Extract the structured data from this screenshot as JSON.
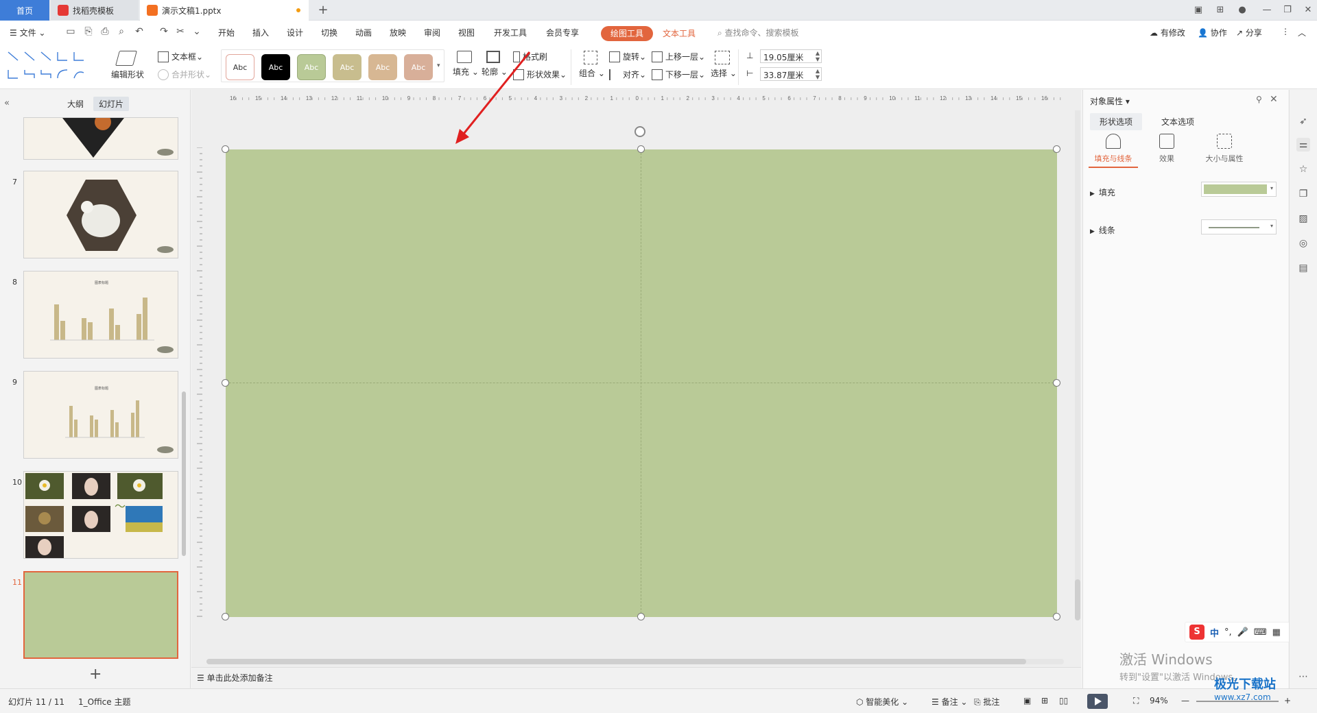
{
  "tabs": [
    {
      "label": "首页"
    },
    {
      "label": "找稻壳模板"
    },
    {
      "label": "演示文稿1.pptx"
    }
  ],
  "menu": {
    "file": "文件",
    "items": [
      "开始",
      "插入",
      "设计",
      "切换",
      "动画",
      "放映",
      "审阅",
      "视图",
      "开发工具",
      "会员专享"
    ],
    "drawing_tools": "绘图工具",
    "text_tools": "文本工具",
    "search_placeholder": "查找命令、搜索模板",
    "right": [
      "有修改",
      "协作",
      "分享"
    ]
  },
  "ribbon": {
    "edit_shape": "编辑形状",
    "textbox": "文本框",
    "merge_shape": "合并形状",
    "style_swatches": [
      {
        "label": "Abc",
        "bg": "#ffffff",
        "fg": "#333333",
        "border": "#e2a59a"
      },
      {
        "label": "Abc",
        "bg": "#000000",
        "fg": "#ffffff",
        "border": "#000000"
      },
      {
        "label": "Abc",
        "bg": "#b9ca97",
        "fg": "#ffffff",
        "border": "#9aab79"
      },
      {
        "label": "Abc",
        "bg": "#c8bd8e",
        "fg": "#ffffff",
        "border": "#b4a878"
      },
      {
        "label": "Abc",
        "bg": "#d7b793",
        "fg": "#ffffff",
        "border": "#c4a07b"
      },
      {
        "label": "Abc",
        "bg": "#d8af99",
        "fg": "#ffffff",
        "border": "#c49681"
      }
    ],
    "fill": "填充",
    "outline": "轮廓",
    "format_painter": "格式刷",
    "shape_effect": "形状效果",
    "group": "组合",
    "rotate": "旋转",
    "align": "对齐",
    "bring_forward": "上移一层",
    "send_backward": "下移一层",
    "select": "选择",
    "height": "19.05厘米",
    "width": "33.87厘米"
  },
  "left_panel": {
    "tab_outline": "大纲",
    "tab_slides": "幻灯片",
    "slides": [
      {
        "num": "",
        "selected": false
      },
      {
        "num": "7",
        "selected": false
      },
      {
        "num": "8",
        "selected": false
      },
      {
        "num": "9",
        "selected": false
      },
      {
        "num": "10",
        "selected": false
      },
      {
        "num": "11",
        "selected": true
      }
    ],
    "chart_title_small": "图表标题"
  },
  "canvas": {
    "ruler_labels": [
      "16",
      "15",
      "14",
      "13",
      "12",
      "11",
      "10",
      "9",
      "8",
      "7",
      "6",
      "5",
      "4",
      "3",
      "2",
      "1",
      "0",
      "1",
      "2",
      "3",
      "4",
      "5",
      "6",
      "7",
      "8",
      "9",
      "10",
      "11",
      "12",
      "13",
      "14",
      "15",
      "16"
    ],
    "slide_color": "#b9ca97",
    "notes_placeholder": "单击此处添加备注"
  },
  "right_pane": {
    "title": "对象属性",
    "tab_shape": "形状选项",
    "tab_text": "文本选项",
    "sub_fill_line": "填充与线条",
    "sub_effect": "效果",
    "sub_size": "大小与属性",
    "row_fill": "填充",
    "row_line": "线条",
    "fill_color": "#b9ca97"
  },
  "ime": {
    "lang": "中"
  },
  "watermark": {
    "line1": "激活 Windows",
    "line2": "转到\"设置\"以激活 Windows。"
  },
  "status": {
    "slide_count": "幻灯片 11 / 11",
    "theme": "1_Office 主题",
    "beautify": "智能美化",
    "notes": "备注",
    "comments": "批注",
    "zoom": "94%"
  },
  "site_logo": {
    "name": "极光下载站",
    "url_text": "www.xz7.com"
  }
}
